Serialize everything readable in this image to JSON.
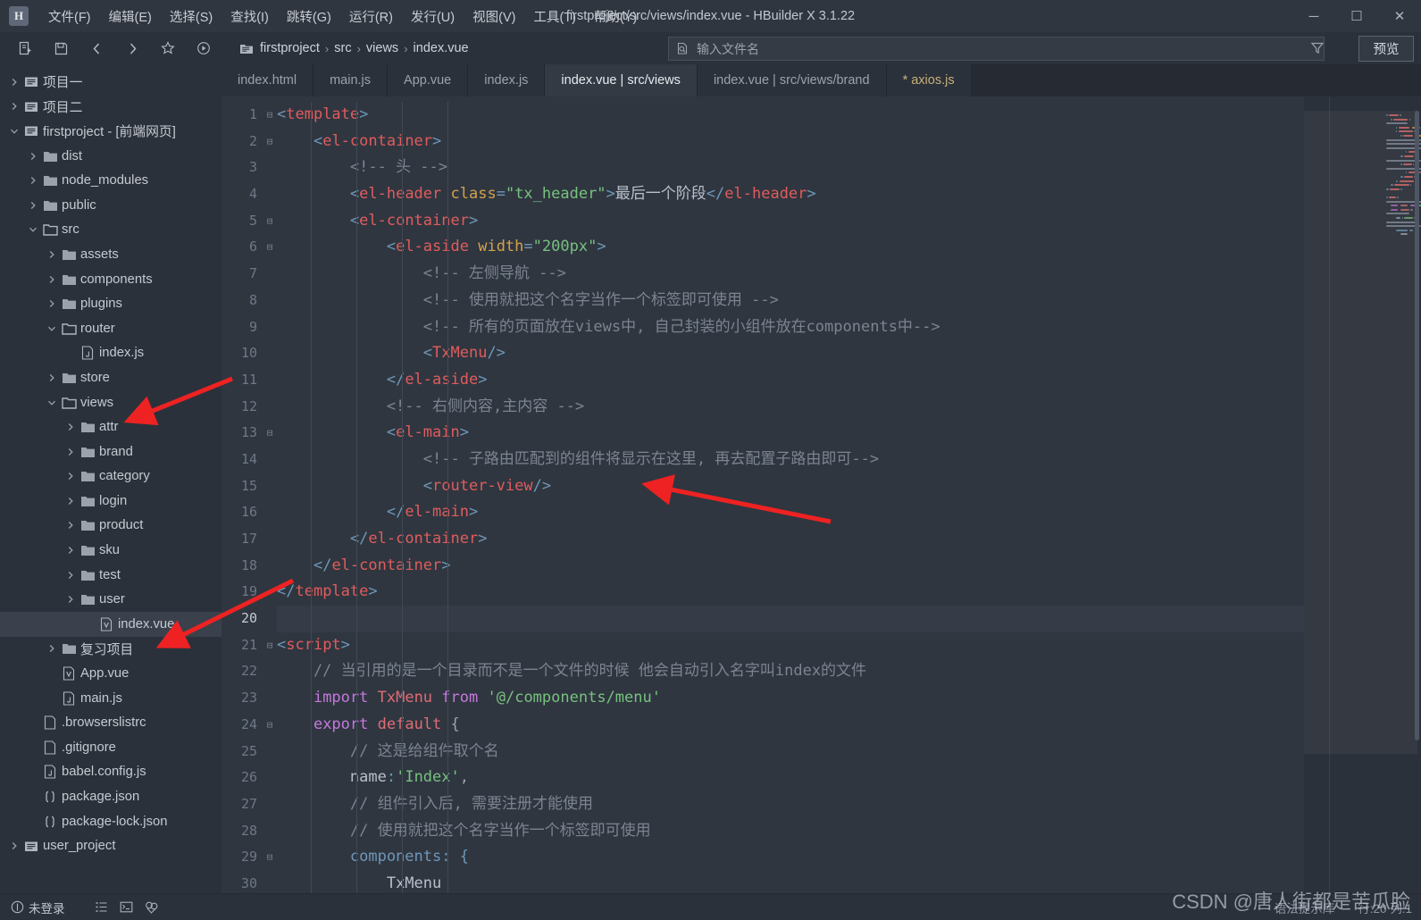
{
  "window": {
    "title": "firstproject/src/views/index.vue - HBuilder X 3.1.22",
    "logo": "H",
    "minimize": "─",
    "maximize": "☐",
    "close": "✕"
  },
  "menubar": {
    "items": [
      {
        "label": "文件(F)",
        "name": "menu-file"
      },
      {
        "label": "编辑(E)",
        "name": "menu-edit"
      },
      {
        "label": "选择(S)",
        "name": "menu-select"
      },
      {
        "label": "查找(I)",
        "name": "menu-find"
      },
      {
        "label": "跳转(G)",
        "name": "menu-goto"
      },
      {
        "label": "运行(R)",
        "name": "menu-run"
      },
      {
        "label": "发行(U)",
        "name": "menu-publish"
      },
      {
        "label": "视图(V)",
        "name": "menu-view"
      },
      {
        "label": "工具(T)",
        "name": "menu-tools"
      },
      {
        "label": "帮助(Y)",
        "name": "menu-help"
      }
    ]
  },
  "toolbar": {
    "icons": [
      "new-file-icon",
      "save-icon",
      "back-icon",
      "forward-icon",
      "star-icon",
      "run-icon"
    ],
    "breadcrumb": [
      "firstproject",
      "src",
      "views",
      "index.vue"
    ],
    "breadcrumb_sep": "›",
    "search": {
      "placeholder": "输入文件名",
      "icon": "file-search-icon"
    },
    "filter_icon": "funnel-icon",
    "preview_label": "预览"
  },
  "sidebar": {
    "items": [
      {
        "label": "项目一",
        "depth": 0,
        "arrow": "collapsed",
        "icon": "project-icon"
      },
      {
        "label": "项目二",
        "depth": 0,
        "arrow": "collapsed",
        "icon": "project-icon"
      },
      {
        "label": "firstproject - [前端网页]",
        "depth": 0,
        "arrow": "expanded",
        "icon": "project-icon"
      },
      {
        "label": "dist",
        "depth": 1,
        "arrow": "collapsed",
        "icon": "folder-icon"
      },
      {
        "label": "node_modules",
        "depth": 1,
        "arrow": "collapsed",
        "icon": "folder-icon"
      },
      {
        "label": "public",
        "depth": 1,
        "arrow": "collapsed",
        "icon": "folder-icon"
      },
      {
        "label": "src",
        "depth": 1,
        "arrow": "expanded",
        "icon": "folder-open-icon"
      },
      {
        "label": "assets",
        "depth": 2,
        "arrow": "collapsed",
        "icon": "folder-icon"
      },
      {
        "label": "components",
        "depth": 2,
        "arrow": "collapsed",
        "icon": "folder-icon"
      },
      {
        "label": "plugins",
        "depth": 2,
        "arrow": "collapsed",
        "icon": "folder-icon"
      },
      {
        "label": "router",
        "depth": 2,
        "arrow": "expanded",
        "icon": "folder-open-icon"
      },
      {
        "label": "index.js",
        "depth": 3,
        "arrow": "none",
        "icon": "js-file-icon"
      },
      {
        "label": "store",
        "depth": 2,
        "arrow": "collapsed",
        "icon": "folder-icon"
      },
      {
        "label": "views",
        "depth": 2,
        "arrow": "expanded",
        "icon": "folder-open-icon"
      },
      {
        "label": "attr",
        "depth": 3,
        "arrow": "collapsed",
        "icon": "folder-icon"
      },
      {
        "label": "brand",
        "depth": 3,
        "arrow": "collapsed",
        "icon": "folder-icon"
      },
      {
        "label": "category",
        "depth": 3,
        "arrow": "collapsed",
        "icon": "folder-icon"
      },
      {
        "label": "login",
        "depth": 3,
        "arrow": "collapsed",
        "icon": "folder-icon"
      },
      {
        "label": "product",
        "depth": 3,
        "arrow": "collapsed",
        "icon": "folder-icon"
      },
      {
        "label": "sku",
        "depth": 3,
        "arrow": "collapsed",
        "icon": "folder-icon"
      },
      {
        "label": "test",
        "depth": 3,
        "arrow": "collapsed",
        "icon": "folder-icon"
      },
      {
        "label": "user",
        "depth": 3,
        "arrow": "collapsed",
        "icon": "folder-icon"
      },
      {
        "label": "index.vue",
        "depth": 4,
        "arrow": "none",
        "icon": "vue-file-icon",
        "selected": true
      },
      {
        "label": "复习项目",
        "depth": 2,
        "arrow": "collapsed",
        "icon": "folder-icon"
      },
      {
        "label": "App.vue",
        "depth": 2,
        "arrow": "none",
        "icon": "vue-file-icon"
      },
      {
        "label": "main.js",
        "depth": 2,
        "arrow": "none",
        "icon": "js-file-icon"
      },
      {
        "label": ".browserslistrc",
        "depth": 1,
        "arrow": "none",
        "icon": "plain-file-icon"
      },
      {
        "label": ".gitignore",
        "depth": 1,
        "arrow": "none",
        "icon": "plain-file-icon"
      },
      {
        "label": "babel.config.js",
        "depth": 1,
        "arrow": "none",
        "icon": "js-file-icon"
      },
      {
        "label": "package.json",
        "depth": 1,
        "arrow": "none",
        "icon": "json-file-icon"
      },
      {
        "label": "package-lock.json",
        "depth": 1,
        "arrow": "none",
        "icon": "json-file-icon"
      },
      {
        "label": "user_project",
        "depth": 0,
        "arrow": "collapsed",
        "icon": "project-icon"
      }
    ]
  },
  "tabs": [
    {
      "label": "index.html",
      "active": false,
      "dirty": false
    },
    {
      "label": "main.js",
      "active": false,
      "dirty": false
    },
    {
      "label": "App.vue",
      "active": false,
      "dirty": false
    },
    {
      "label": "index.js",
      "active": false,
      "dirty": false
    },
    {
      "label": "index.vue | src/views",
      "active": true,
      "dirty": false
    },
    {
      "label": "index.vue | src/views/brand",
      "active": false,
      "dirty": false
    },
    {
      "label": "* axios.js",
      "active": false,
      "dirty": true
    }
  ],
  "editor": {
    "current_line": 20,
    "lines": [
      {
        "n": 1,
        "fold": "⊟",
        "tokens": [
          {
            "t": "brk",
            "v": "<"
          },
          {
            "t": "tag",
            "v": "template"
          },
          {
            "t": "brk",
            "v": ">"
          }
        ]
      },
      {
        "n": 2,
        "fold": "⊟",
        "tokens": [
          {
            "t": "plain",
            "v": "    "
          },
          {
            "t": "brk",
            "v": "<"
          },
          {
            "t": "tag",
            "v": "el-container"
          },
          {
            "t": "brk",
            "v": ">"
          }
        ]
      },
      {
        "n": 3,
        "fold": "",
        "tokens": [
          {
            "t": "cmt",
            "v": "        <!-- 头 -->"
          }
        ]
      },
      {
        "n": 4,
        "fold": "",
        "tokens": [
          {
            "t": "plain",
            "v": "        "
          },
          {
            "t": "brk",
            "v": "<"
          },
          {
            "t": "tag",
            "v": "el-header"
          },
          {
            "t": "plain",
            "v": " "
          },
          {
            "t": "attr",
            "v": "class"
          },
          {
            "t": "brk",
            "v": "="
          },
          {
            "t": "str",
            "v": "\"tx_header\""
          },
          {
            "t": "brk",
            "v": ">"
          },
          {
            "t": "txt",
            "v": "最后一个阶段"
          },
          {
            "t": "brk",
            "v": "</"
          },
          {
            "t": "tag",
            "v": "el-header"
          },
          {
            "t": "brk",
            "v": ">"
          }
        ]
      },
      {
        "n": 5,
        "fold": "⊟",
        "tokens": [
          {
            "t": "plain",
            "v": "        "
          },
          {
            "t": "brk",
            "v": "<"
          },
          {
            "t": "tag",
            "v": "el-container"
          },
          {
            "t": "brk",
            "v": ">"
          }
        ]
      },
      {
        "n": 6,
        "fold": "⊟",
        "tokens": [
          {
            "t": "plain",
            "v": "            "
          },
          {
            "t": "brk",
            "v": "<"
          },
          {
            "t": "tag",
            "v": "el-aside"
          },
          {
            "t": "plain",
            "v": " "
          },
          {
            "t": "attr",
            "v": "width"
          },
          {
            "t": "brk",
            "v": "="
          },
          {
            "t": "str",
            "v": "\"200px\""
          },
          {
            "t": "brk",
            "v": ">"
          }
        ]
      },
      {
        "n": 7,
        "fold": "",
        "tokens": [
          {
            "t": "cmt",
            "v": "                <!-- 左侧导航 -->"
          }
        ]
      },
      {
        "n": 8,
        "fold": "",
        "tokens": [
          {
            "t": "cmt",
            "v": "                <!-- 使用就把这个名字当作一个标签即可使用 -->"
          }
        ]
      },
      {
        "n": 9,
        "fold": "",
        "tokens": [
          {
            "t": "cmt",
            "v": "                <!-- 所有的页面放在views中, 自己封装的小组件放在components中-->"
          }
        ]
      },
      {
        "n": 10,
        "fold": "",
        "tokens": [
          {
            "t": "plain",
            "v": "                "
          },
          {
            "t": "brk",
            "v": "<"
          },
          {
            "t": "tag",
            "v": "TxMenu"
          },
          {
            "t": "brk",
            "v": "/>"
          }
        ]
      },
      {
        "n": 11,
        "fold": "",
        "tokens": [
          {
            "t": "plain",
            "v": "            "
          },
          {
            "t": "brk",
            "v": "</"
          },
          {
            "t": "tag",
            "v": "el-aside"
          },
          {
            "t": "brk",
            "v": ">"
          }
        ]
      },
      {
        "n": 12,
        "fold": "",
        "tokens": [
          {
            "t": "cmt",
            "v": "            <!-- 右侧内容,主内容 -->"
          }
        ]
      },
      {
        "n": 13,
        "fold": "⊟",
        "tokens": [
          {
            "t": "plain",
            "v": "            "
          },
          {
            "t": "brk",
            "v": "<"
          },
          {
            "t": "tag",
            "v": "el-main"
          },
          {
            "t": "brk",
            "v": ">"
          }
        ]
      },
      {
        "n": 14,
        "fold": "",
        "tokens": [
          {
            "t": "cmt",
            "v": "                <!-- 子路由匹配到的组件将显示在这里, 再去配置子路由即可-->"
          }
        ]
      },
      {
        "n": 15,
        "fold": "",
        "tokens": [
          {
            "t": "plain",
            "v": "                "
          },
          {
            "t": "brk",
            "v": "<"
          },
          {
            "t": "tag",
            "v": "router-view"
          },
          {
            "t": "brk",
            "v": "/>"
          }
        ]
      },
      {
        "n": 16,
        "fold": "",
        "tokens": [
          {
            "t": "plain",
            "v": "            "
          },
          {
            "t": "brk",
            "v": "</"
          },
          {
            "t": "tag",
            "v": "el-main"
          },
          {
            "t": "brk",
            "v": ">"
          }
        ]
      },
      {
        "n": 17,
        "fold": "",
        "tokens": [
          {
            "t": "plain",
            "v": "        "
          },
          {
            "t": "brk",
            "v": "</"
          },
          {
            "t": "tag",
            "v": "el-container"
          },
          {
            "t": "brk",
            "v": ">"
          }
        ]
      },
      {
        "n": 18,
        "fold": "",
        "tokens": [
          {
            "t": "plain",
            "v": "    "
          },
          {
            "t": "brk",
            "v": "</"
          },
          {
            "t": "tag",
            "v": "el-container"
          },
          {
            "t": "brk",
            "v": ">"
          }
        ]
      },
      {
        "n": 19,
        "fold": "",
        "tokens": [
          {
            "t": "brk",
            "v": "</"
          },
          {
            "t": "tag",
            "v": "template"
          },
          {
            "t": "brk",
            "v": ">"
          }
        ]
      },
      {
        "n": 20,
        "fold": "",
        "tokens": [],
        "current": true
      },
      {
        "n": 21,
        "fold": "⊟",
        "tokens": [
          {
            "t": "brk",
            "v": "<"
          },
          {
            "t": "tag",
            "v": "script"
          },
          {
            "t": "brk",
            "v": ">"
          }
        ]
      },
      {
        "n": 22,
        "fold": "",
        "tokens": [
          {
            "t": "cmt",
            "v": "    // 当引用的是一个目录而不是一个文件的时候 他会自动引入名字叫index的文件"
          }
        ]
      },
      {
        "n": 23,
        "fold": "",
        "tokens": [
          {
            "t": "plain",
            "v": "    "
          },
          {
            "t": "kw",
            "v": "import"
          },
          {
            "t": "plain",
            "v": " "
          },
          {
            "t": "cls",
            "v": "TxMenu"
          },
          {
            "t": "plain",
            "v": " "
          },
          {
            "t": "kw",
            "v": "from"
          },
          {
            "t": "plain",
            "v": " "
          },
          {
            "t": "str",
            "v": "'@/components/menu'"
          }
        ]
      },
      {
        "n": 24,
        "fold": "⊟",
        "tokens": [
          {
            "t": "plain",
            "v": "    "
          },
          {
            "t": "kw",
            "v": "export"
          },
          {
            "t": "plain",
            "v": " "
          },
          {
            "t": "cls",
            "v": "default"
          },
          {
            "t": "plain",
            "v": " {"
          }
        ]
      },
      {
        "n": 25,
        "fold": "",
        "tokens": [
          {
            "t": "cmt",
            "v": "        // 这是给组件取个名"
          }
        ]
      },
      {
        "n": 26,
        "fold": "",
        "tokens": [
          {
            "t": "plain",
            "v": "        "
          },
          {
            "t": "txt",
            "v": "name"
          },
          {
            "t": "brk",
            "v": ":"
          },
          {
            "t": "str",
            "v": "'Index'"
          },
          {
            "t": "plain",
            "v": ","
          }
        ]
      },
      {
        "n": 27,
        "fold": "",
        "tokens": [
          {
            "t": "cmt",
            "v": "        // 组件引入后, 需要注册才能使用"
          }
        ]
      },
      {
        "n": 28,
        "fold": "",
        "tokens": [
          {
            "t": "cmt",
            "v": "        // 使用就把这个名字当作一个标签即可使用"
          }
        ]
      },
      {
        "n": 29,
        "fold": "⊟",
        "tokens": [
          {
            "t": "plain",
            "v": "        "
          },
          {
            "t": "prop",
            "v": "components"
          },
          {
            "t": "brk",
            "v": ": {"
          }
        ]
      },
      {
        "n": 30,
        "fold": "",
        "tokens": [
          {
            "t": "plain",
            "v": "            "
          },
          {
            "t": "txt",
            "v": "TxMenu"
          }
        ]
      }
    ]
  },
  "statusbar": {
    "login_label": "未登录",
    "login_icon": "user-circle-icon",
    "icons": [
      "outline-icon",
      "terminal-icon",
      "plugins-icon"
    ],
    "syntax_label": "语法提示库",
    "cursor_label": "行:20 列:1"
  },
  "watermark": "CSDN @唐人街都是苦瓜脸",
  "colors": {
    "accent_red": "#e05c5c",
    "string_green": "#78c17f",
    "attr_orange": "#d3a24c",
    "comment_grey": "#7c8491",
    "keyword_purple": "#c678dd",
    "annotation_arrow": "#ee2222",
    "bg_editor": "#2f3640",
    "bg_chrome": "#2b313a"
  }
}
